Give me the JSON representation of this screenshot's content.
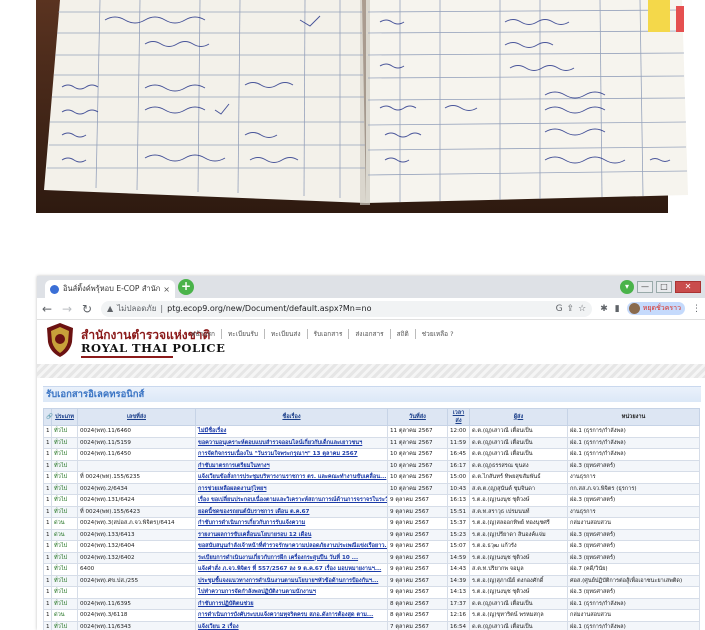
{
  "browser": {
    "tab_title": "อินส์ติ้งค์พรุ้หอบ E-COP สำนักงานต",
    "tab_close": "×",
    "new_tab": "+",
    "url_warning": "ไม่ปลอดภัย",
    "url": "ptg.ecop9.org/new/Document/default.aspx?Mn=no",
    "profile_label": "หยุดชั่วคราว",
    "win_minimize": "—",
    "win_restore": "□",
    "win_close": "✕"
  },
  "site": {
    "org_thai": "สำนักงานตำรวจแห่งชาติ",
    "org_en": "ROYAL THAI POLICE",
    "menu": [
      "หน้าแรก",
      "ทะเบียนรับ",
      "ทะเบียนส่ง",
      "รับเอกสาร",
      "ส่งเอกสาร",
      "สถิติ",
      "ช่วยเหลือ ?"
    ]
  },
  "panel": {
    "title": "รับเอกสารอิเลคทรอนิกส์"
  },
  "table": {
    "columns": [
      "",
      "ประเภท",
      "เลขที่ส่ง",
      "ชื่อเรื่อง",
      "วันที่ส่ง",
      "เวลาส่ง",
      "ผู้ส่ง",
      "หน่วยงาน"
    ],
    "rows": [
      [
        "1",
        "ทั่วไป",
        "0024(พท).11/6460",
        "ไม่มีชื่อเรื่อง",
        "11 ตุลาคม 2567",
        "12:00",
        "ด.ต.(ญ)เสาวณี เตื่อนเป็น",
        "ฝอ.1 (ธุรการ/กำลังพล)"
      ],
      [
        "1",
        "ทั่วไป",
        "0024(พท).11/5159",
        "ขอความอนุเคราะห์ตอบแบบสำรวจออนไลน์เกี่ยวกับเด็กและเยาวชนฯ",
        "11 ตุลาคม 2567",
        "11:59",
        "ด.ต.(ญ)เสาวณี เตื่อนเป็น",
        "ฝอ.1 (ธุรการ/กำลังพล)"
      ],
      [
        "1",
        "ทั่วไป",
        "0024(พท).11/6450",
        "การจัดกิจกรรมเนื่องใน \"วันรวมใจพระกรุณาฯ\" 13 ตุลาคม 2567",
        "10 ตุลาคม 2567",
        "16:45",
        "ด.ต.(ญ)เสาวณี เตื่อนเป็น",
        "ฝอ.1 (ธุรการ/กำลังพล)"
      ],
      [
        "1",
        "ทั่วไป",
        "",
        "กำชับมาตรการเตรียมในทางฯ",
        "10 ตุลาคม 2567",
        "16:17",
        "ด.ต.(ญ)ธรรสรณ ขุนสง",
        "ฝอ.3 (ยุทธศาสตร์)"
      ],
      [
        "1",
        "ทั่วไป",
        "ที่ 0024(พท).155/6235",
        "แจ้งเวียนข้อสั่งการประชุมบริหารงานราชการ ตร. และคณะทำงานขับเคลื่อน...",
        "10 ตุลาคม 2567",
        "15:00",
        "ด.ต.ไกสันทร์ ทิพยสุขสัมพันธ์",
        "งานธุรการ"
      ],
      [
        "1",
        "ทั่วไป",
        "0024(พท).2/6434",
        "การช่วยเหลือผลดงานกุ่ไทยฯ",
        "10 ตุลาคม 2567",
        "10:43",
        "ส.ต.ต.(ญ)สุนันต์ ชุมจินดา",
        "กก.สส.ภ.จว.พิจิตร (ธุรการ)"
      ],
      [
        "1",
        "ทั่วไป",
        "0024(พท).131/6424",
        "เรื่อง ขอเปลี่ยนประกอบเนื่องตามและวิเคราะห์สถานการณ์ด้านการจราจรในระวัน...",
        "9 ตุลาคม 2567",
        "16:13",
        "ร.ต.อ.(ญ)นงนุช ชุติวงษ์",
        "ฝอ.3 (ยุทธศาสตร์)"
      ],
      [
        "1",
        "ทั่วไป",
        "ที่ 0024(พท).155/6423",
        "ยอดนี้ชดของรถยนต์นับราชการ เดือน ต.ค.67",
        "9 ตุลาคม 2567",
        "15:51",
        "ส.ต.ท.สราวุธ เปรมนนท์",
        "งานธุรการ"
      ],
      [
        "1",
        "ด่วน",
        "0024(พท).3(สปอส.ภ.จว.พิจิตร)/6414",
        "กำชับการดำเนินการเกี่ยวกับการรับแจ้งความ",
        "9 ตุลาคม 2567",
        "15:37",
        "ร.ต.อ.(ญ)สลออกทิพย์ ทองนุชศรี",
        "กล่มงานสอบสวน"
      ],
      [
        "1",
        "ด่วน",
        "0024(พท).133/6413",
        "รายงานผลการขับเคลื่อนนโยบายรอบ 12 เดือน",
        "9 ตุลาคม 2567",
        "15:23",
        "ร.ต.อ.(ญ)ปรียาดา สินองค์แจ่ม",
        "ฝอ.3 (ยุทธศาสตร์)"
      ],
      [
        "1",
        "ทั่วไป",
        "0024(พท).132/6404",
        "ขอสนับสนุนกำลังเจ้าหน้าที่ตำรวจรักษาความปลอดภัยงานประเพณีแข่งเรือยาว...",
        "9 ตุลาคม 2567",
        "15:07",
        "ร.ต.อ.ธวุฒ แก้วรัง",
        "ฝอ.3 (ยุทธศาสตร์)"
      ],
      [
        "1",
        "ทั่วไป",
        "0024(พท).132/6402",
        "ระเบียบการดำเนินงานเกี่ยวกับการฝึก เครื่องกระสุนปืน วันที่ 10 ...",
        "9 ตุลาคม 2567",
        "14:59",
        "ร.ต.อ.(ญ)นงนุช ชุติวงษ์",
        "ฝอ.3 (ยุทธศาสตร์)"
      ],
      [
        "1",
        "ทั่วไป",
        "6400",
        "แจ้งคำสั่ง ภ.จว.พิจิตร ที่ 557/2567 ลง 9 ต.ค.67 เรื่อง มอบหมายงานฯ...",
        "9 ตุลาคม 2567",
        "14:43",
        "ส.ต.ท.ปริยากพ จอมูล",
        "ฝอ.7 (คดี/วินัย)"
      ],
      [
        "1",
        "ทั่วไป",
        "0024(พท).ศข.ปส./255",
        "ประชุมชี้แจงแนวทางการดำเนินงานตามนโยบายฯหัวข้อด้านการป้องกันฯ...",
        "9 ตุลาคม 2567",
        "14:39",
        "ร.ต.อ.(ญ)สุภาณีย์ ตงกองศักดิ์",
        "ศอส.(ศูนย์ปฏิบัติการต่อสู้เพื่อเอาชนะยาเสพติด)"
      ],
      [
        "1",
        "ทั่วไป",
        "",
        "ไปทำความการจัดกำลังพลปฏิบัติงานตามนักงานฯ",
        "9 ตุลาคม 2567",
        "14:13",
        "ร.ต.อ.(ญ)นงนุช ชุติวงษ์",
        "ฝอ.3 (ยุทธศาสตร์)"
      ],
      [
        "1",
        "ทั่วไป",
        "0024(พท).11/6395",
        "กำชับการปฏิบัติตนช่วย",
        "8 ตุลาคม 2567",
        "17:37",
        "ด.ต.(ญ)เสาวณี เตื่อนเป็น",
        "ฝอ.1 (ธุรการ/กำลังพล)"
      ],
      [
        "1",
        "ด่วน",
        "0024(พท).3/6118",
        "การดำเนินการบังคับระบบแจ้งความทุจริตครบ สภอ.ดังการต้องสุด ตาม...",
        "8 ตุลาคม 2567",
        "12:16",
        "ร.ต.อ.(ญ)ขุทาริตน์ พรหมสกุล",
        "กล่มงานสอบสวน"
      ],
      [
        "1",
        "ทั่วไป",
        "0024(พท).11/6343",
        "แจ้งเวียน 2 เรื่อง",
        "7 ตุลาคม 2567",
        "16:54",
        "ด.ต.(ญ)เสาวณี เตื่อนเป็น",
        "ฝอ.1 (ธุรการ/กำลังพล)"
      ]
    ]
  },
  "colors": {
    "org_red": "#8b1a1a",
    "link_blue": "#1a3aa8",
    "panel_title_blue": "#3a74c4",
    "header_row_bg": "#dde6f3"
  }
}
